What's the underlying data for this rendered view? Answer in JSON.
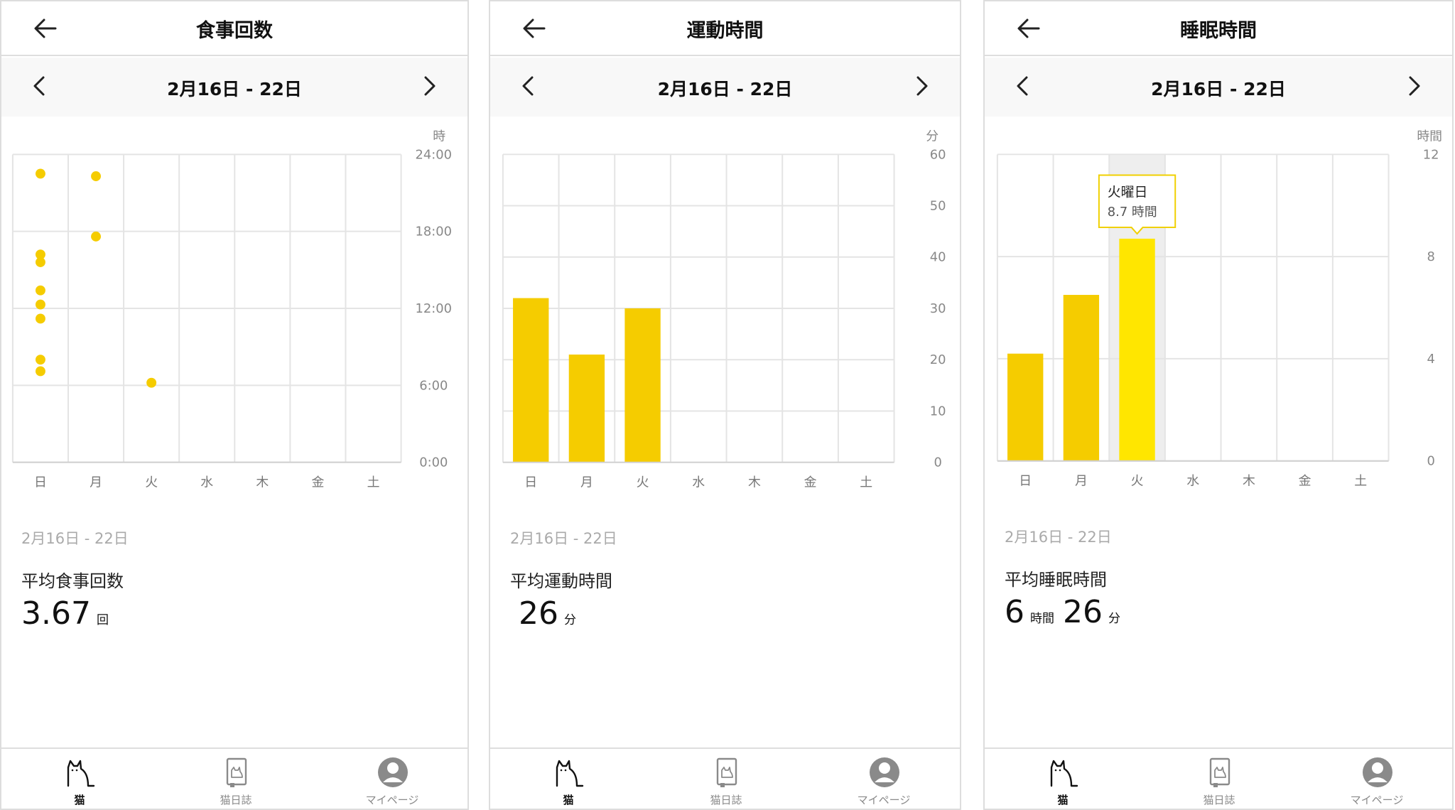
{
  "colors": {
    "bar": "#f5cc00",
    "bar_highlight": "#ffe600",
    "dot": "#f5cc00",
    "grid": "#e4e4e4",
    "tooltip_border": "#f0d000"
  },
  "icons": {
    "back": "arrow-left-icon",
    "prev": "chevron-left-icon",
    "next": "chevron-right-icon",
    "tab_cat": "cat-icon",
    "tab_diary": "diary-book-icon",
    "tab_mypage": "user-avatar-icon"
  },
  "screens": [
    {
      "title": "食事回数",
      "date_range": "2月16日 - 22日",
      "summary": {
        "range": "2月16日 - 22日",
        "label": "平均食事回数",
        "value": "3.67",
        "unit": "回"
      },
      "tabs": [
        {
          "label": "猫",
          "active": true
        },
        {
          "label": "猫日誌"
        },
        {
          "label": "マイページ"
        }
      ]
    },
    {
      "title": "運動時間",
      "date_range": "2月16日 - 22日",
      "summary": {
        "range": "2月16日 - 22日",
        "label": "平均運動時間",
        "value": "26",
        "unit": "分"
      },
      "tabs": [
        {
          "label": "猫",
          "active": true
        },
        {
          "label": "猫日誌"
        },
        {
          "label": "マイページ"
        }
      ]
    },
    {
      "title": "睡眠時間",
      "date_range": "2月16日 - 22日",
      "summary": {
        "range": "2月16日 - 22日",
        "label": "平均睡眠時間",
        "value_hours": "6",
        "unit_hours": "時間",
        "value_minutes": "26",
        "unit_minutes": "分"
      },
      "tooltip": {
        "title": "火曜日",
        "value": "8.7 時間"
      },
      "tabs": [
        {
          "label": "猫",
          "active": true
        },
        {
          "label": "猫日誌"
        },
        {
          "label": "マイページ"
        }
      ]
    }
  ],
  "chart_data": [
    {
      "type": "scatter",
      "categories": [
        "日",
        "月",
        "火",
        "水",
        "木",
        "金",
        "土"
      ],
      "ylabel": "時",
      "ylim": [
        0,
        24
      ],
      "ytick_labels": [
        "0:00",
        "6:00",
        "12:00",
        "18:00",
        "24:00"
      ],
      "points": [
        {
          "x": "日",
          "y": 22.5
        },
        {
          "x": "日",
          "y": 16.2
        },
        {
          "x": "日",
          "y": 15.6
        },
        {
          "x": "日",
          "y": 13.4
        },
        {
          "x": "日",
          "y": 12.3
        },
        {
          "x": "日",
          "y": 11.2
        },
        {
          "x": "日",
          "y": 8.0
        },
        {
          "x": "日",
          "y": 7.1
        },
        {
          "x": "月",
          "y": 22.3
        },
        {
          "x": "月",
          "y": 17.6
        },
        {
          "x": "火",
          "y": 6.2
        }
      ],
      "grid": true
    },
    {
      "type": "bar",
      "categories": [
        "日",
        "月",
        "火",
        "水",
        "木",
        "金",
        "土"
      ],
      "values": [
        32,
        21,
        30,
        0,
        0,
        0,
        0
      ],
      "ylabel": "分",
      "ylim": [
        0,
        60
      ],
      "yticks": [
        0,
        10,
        20,
        30,
        40,
        50,
        60
      ],
      "grid": true
    },
    {
      "type": "bar",
      "categories": [
        "日",
        "月",
        "火",
        "水",
        "木",
        "金",
        "土"
      ],
      "values": [
        4.2,
        6.5,
        8.7,
        0,
        0,
        0,
        0
      ],
      "ylabel": "時間",
      "ylim": [
        0,
        12
      ],
      "yticks": [
        0,
        4,
        8,
        12
      ],
      "highlight_index": 2,
      "grid": true
    }
  ]
}
